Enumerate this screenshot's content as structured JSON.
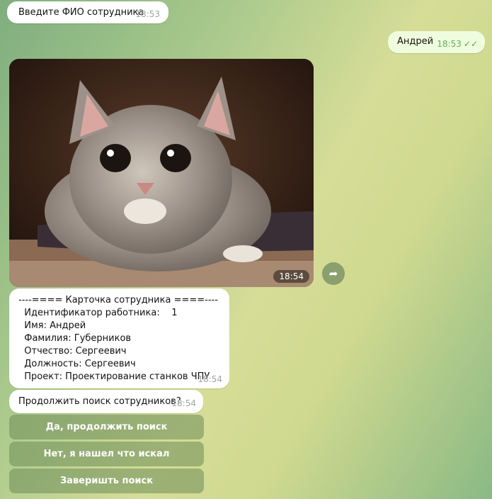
{
  "messages": {
    "prompt": {
      "text": "Введите ФИО сотрудника",
      "time": "18:53"
    },
    "reply": {
      "text": "Андрей",
      "time": "18:53",
      "status_icon": "double-check-icon"
    },
    "photo": {
      "time": "18:54"
    },
    "card": {
      "lines": [
        "----==== Карточка сотрудника ====----",
        "  Идентификатор работника:    1",
        "  Имя: Андрей",
        "  Фамилия: Губерников",
        "  Отчество: Сергеевич",
        "  Должность: Сергеевич",
        "  Проект: Проектирование станков ЧПУ"
      ],
      "time": "18:54"
    },
    "continue": {
      "text": "Продолжить поиск сотрудников?",
      "time": "18:54"
    }
  },
  "keyboard": {
    "buttons": [
      "Да, продолжить поиск",
      "Нет, я нашел что искал",
      "Заверишть поиск"
    ]
  },
  "colors": {
    "outgoing_bubble": "#effdde",
    "incoming_bubble": "#ffffff",
    "read_ticks": "#4fae4e"
  }
}
